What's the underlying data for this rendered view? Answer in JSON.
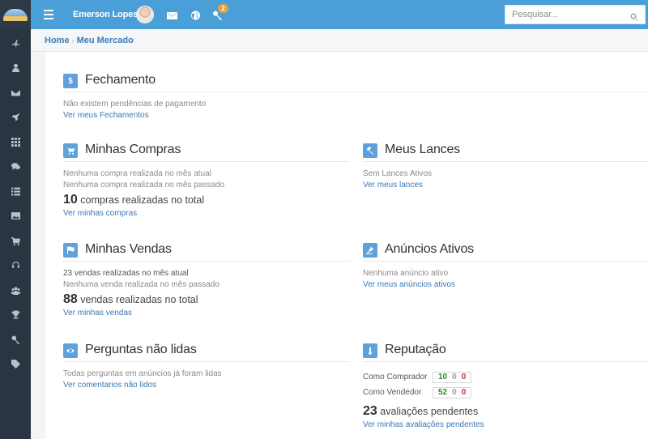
{
  "topbar": {
    "user_name": "Emerson Lopes",
    "notification_count": "2",
    "search_placeholder": "Pesquisar..."
  },
  "breadcrumb": {
    "home": "Home",
    "current": "Meu Mercado"
  },
  "sidebar": {
    "icons": [
      "plane-icon",
      "user-icon",
      "envelope-icon",
      "rocket-icon",
      "grid-icon",
      "comments-icon",
      "list-icon",
      "image-icon",
      "cart-icon",
      "headset-icon",
      "group-icon",
      "trophy-icon",
      "key-icon",
      "tag-icon"
    ]
  },
  "sections": {
    "fechamento": {
      "title": "Fechamento",
      "line1": "Não existem pendências de pagamento",
      "link": "Ver meus Fechamentos"
    },
    "compras": {
      "title": "Minhas Compras",
      "line1": "Nenhuma compra realizada no mês atual",
      "line2": "Nenhuma compra realizada no mês passado",
      "total_number": "10",
      "total_text": "compras realizadas no total",
      "link": "Ver minhas compras"
    },
    "lances": {
      "title": "Meus Lances",
      "line1": "Sem Lances Ativos",
      "link": "Ver meus lances"
    },
    "vendas": {
      "title": "Minhas Vendas",
      "line1": "23 vendas realizadas no mês atual",
      "line2": "Nenhuma venda realizada no mês passado",
      "total_number": "88",
      "total_text": "vendas realizadas no total",
      "link": "Ver minhas vendas"
    },
    "anuncios": {
      "title": "Anúncios Ativos",
      "line1": "Nenhuma anúncio ativo",
      "link": "Ver meus anúncios ativos"
    },
    "perguntas": {
      "title": "Perguntas não lidas",
      "line1": "Todas perguntas em anúncios já foram lidas",
      "link": "Ver comentarios não lidos"
    },
    "reputacao": {
      "title": "Reputação",
      "comprador_label": "Como Comprador",
      "comprador_pos": "10",
      "comprador_neu": "0",
      "comprador_neg": "0",
      "vendedor_label": "Como Vendedor",
      "vendedor_pos": "52",
      "vendedor_neu": "0",
      "vendedor_neg": "0",
      "pendentes_number": "23",
      "pendentes_text": "avaliações pendentes",
      "link": "Ver minhas avaliações pendentes"
    }
  },
  "colors": {
    "topbar": "#4a9fd8",
    "sidebar": "#2b3542",
    "accent_icon": "#5fa2db",
    "link": "#3a78b3",
    "positive": "#2b8a2b",
    "negative": "#d02b2b"
  }
}
